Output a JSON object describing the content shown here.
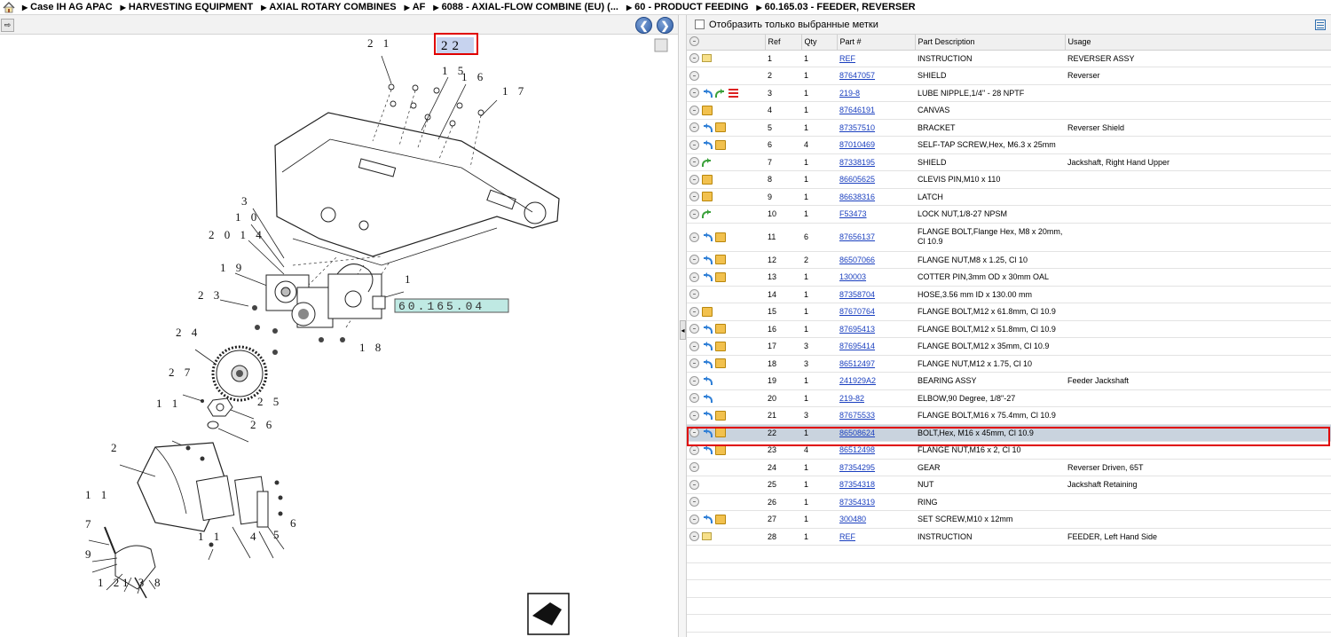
{
  "breadcrumb": [
    "Case IH AG APAC",
    "HARVESTING EQUIPMENT",
    "AXIAL ROTARY COMBINES",
    "AF",
    "6088 - AXIAL-FLOW COMBINE (EU) (...",
    "60 - PRODUCT FEEDING",
    "60.165.03 - FEEDER, REVERSER"
  ],
  "filter": {
    "label": "Отобразить только выбранные метки"
  },
  "table": {
    "headers": [
      "Ref",
      "Qty",
      "Part #",
      "Part Description",
      "Usage"
    ],
    "rows": [
      {
        "icons": [
          "plus",
          "note"
        ],
        "ref": "1",
        "qty": "1",
        "part": "REF",
        "desc": "INSTRUCTION",
        "usage": "REVERSER ASSY"
      },
      {
        "icons": [
          "plus"
        ],
        "ref": "2",
        "qty": "1",
        "part": "87647057",
        "desc": "SHIELD",
        "usage": "Reverser"
      },
      {
        "icons": [
          "plus",
          "undo",
          "redo",
          "lines"
        ],
        "ref": "3",
        "qty": "1",
        "part": "219-8",
        "desc": "LUBE NIPPLE,1/4\" - 28 NPTF",
        "usage": ""
      },
      {
        "icons": [
          "plus",
          "box"
        ],
        "ref": "4",
        "qty": "1",
        "part": "87646191",
        "desc": "CANVAS",
        "usage": ""
      },
      {
        "icons": [
          "plus",
          "undo",
          "box"
        ],
        "ref": "5",
        "qty": "1",
        "part": "87357510",
        "desc": "BRACKET",
        "usage": "Reverser Shield"
      },
      {
        "icons": [
          "plus",
          "undo",
          "box"
        ],
        "ref": "6",
        "qty": "4",
        "part": "87010469",
        "desc": "SELF-TAP SCREW,Hex, M6.3 x 25mm",
        "usage": ""
      },
      {
        "icons": [
          "plus",
          "redo"
        ],
        "ref": "7",
        "qty": "1",
        "part": "87338195",
        "desc": "SHIELD",
        "usage": "Jackshaft, Right Hand Upper"
      },
      {
        "icons": [
          "plus",
          "box"
        ],
        "ref": "8",
        "qty": "1",
        "part": "86605625",
        "desc": "CLEVIS PIN,M10 x 110",
        "usage": ""
      },
      {
        "icons": [
          "plus",
          "box"
        ],
        "ref": "9",
        "qty": "1",
        "part": "86638316",
        "desc": "LATCH",
        "usage": ""
      },
      {
        "icons": [
          "plus",
          "redo"
        ],
        "ref": "10",
        "qty": "1",
        "part": "F53473",
        "desc": "LOCK NUT,1/8-27 NPSM",
        "usage": ""
      },
      {
        "icons": [
          "plus",
          "undo",
          "box"
        ],
        "ref": "11",
        "qty": "6",
        "part": "87656137",
        "desc": "FLANGE BOLT,Flange Hex, M8 x 20mm, Cl 10.9",
        "usage": "",
        "tall": true
      },
      {
        "icons": [
          "plus",
          "undo",
          "box"
        ],
        "ref": "12",
        "qty": "2",
        "part": "86507066",
        "desc": "FLANGE NUT,M8 x 1.25, Cl 10",
        "usage": ""
      },
      {
        "icons": [
          "plus",
          "undo",
          "box"
        ],
        "ref": "13",
        "qty": "1",
        "part": "130003",
        "desc": "COTTER PIN,3mm OD x 30mm OAL",
        "usage": ""
      },
      {
        "icons": [
          "plus"
        ],
        "ref": "14",
        "qty": "1",
        "part": "87358704",
        "desc": "HOSE,3.56 mm ID x 130.00 mm",
        "usage": ""
      },
      {
        "icons": [
          "plus",
          "box"
        ],
        "ref": "15",
        "qty": "1",
        "part": "87670764",
        "desc": "FLANGE BOLT,M12 x 61.8mm, Cl 10.9",
        "usage": ""
      },
      {
        "icons": [
          "plus",
          "undo",
          "box"
        ],
        "ref": "16",
        "qty": "1",
        "part": "87695413",
        "desc": "FLANGE BOLT,M12 x 51.8mm, Cl 10.9",
        "usage": ""
      },
      {
        "icons": [
          "plus",
          "undo",
          "box"
        ],
        "ref": "17",
        "qty": "3",
        "part": "87695414",
        "desc": "FLANGE BOLT,M12 x 35mm, Cl 10.9",
        "usage": ""
      },
      {
        "icons": [
          "plus",
          "undo",
          "box"
        ],
        "ref": "18",
        "qty": "3",
        "part": "86512497",
        "desc": "FLANGE NUT,M12 x 1.75, Cl 10",
        "usage": ""
      },
      {
        "icons": [
          "plus",
          "undo"
        ],
        "ref": "19",
        "qty": "1",
        "part": "241929A2",
        "desc": "BEARING ASSY",
        "usage": "Feeder Jackshaft"
      },
      {
        "icons": [
          "plus",
          "undo"
        ],
        "ref": "20",
        "qty": "1",
        "part": "219-82",
        "desc": "ELBOW,90 Degree, 1/8\"-27",
        "usage": ""
      },
      {
        "icons": [
          "plus",
          "undo",
          "box"
        ],
        "ref": "21",
        "qty": "3",
        "part": "87675533",
        "desc": "FLANGE BOLT,M16 x 75.4mm, Cl 10.9",
        "usage": ""
      },
      {
        "icons": [
          "plus",
          "undo",
          "box"
        ],
        "ref": "22",
        "qty": "1",
        "part": "86508624",
        "desc": "BOLT,Hex, M16 x 45mm, Cl 10.9",
        "usage": "",
        "selected": true
      },
      {
        "icons": [
          "plus",
          "undo",
          "box"
        ],
        "ref": "23",
        "qty": "4",
        "part": "86512498",
        "desc": "FLANGE NUT,M16 x 2, Cl 10",
        "usage": ""
      },
      {
        "icons": [
          "plus"
        ],
        "ref": "24",
        "qty": "1",
        "part": "87354295",
        "desc": "GEAR",
        "usage": "Reverser Driven, 65T"
      },
      {
        "icons": [
          "plus"
        ],
        "ref": "25",
        "qty": "1",
        "part": "87354318",
        "desc": "NUT",
        "usage": "Jackshaft Retaining"
      },
      {
        "icons": [
          "plus"
        ],
        "ref": "26",
        "qty": "1",
        "part": "87354319",
        "desc": "RING",
        "usage": ""
      },
      {
        "icons": [
          "plus",
          "undo",
          "box"
        ],
        "ref": "27",
        "qty": "1",
        "part": "300480",
        "desc": "SET SCREW,M10 x 12mm",
        "usage": ""
      },
      {
        "icons": [
          "plus",
          "note"
        ],
        "ref": "28",
        "qty": "1",
        "part": "REF",
        "desc": "INSTRUCTION",
        "usage": "FEEDER, Left Hand Side"
      }
    ]
  },
  "diagram": {
    "code": "60.165.04",
    "callouts": [
      "1",
      "2",
      "3",
      "4",
      "5",
      "6",
      "7",
      "8",
      "9",
      "10",
      "11",
      "11",
      "11",
      "12",
      "13",
      "14",
      "15",
      "16",
      "17",
      "18",
      "19",
      "20",
      "21",
      "22",
      "23",
      "24",
      "25",
      "26",
      "27"
    ],
    "highlighted_callout": "22"
  },
  "colors": {
    "selected_row": "#c9d3de",
    "highlight": "#e00000",
    "link": "#1a3fbf"
  }
}
